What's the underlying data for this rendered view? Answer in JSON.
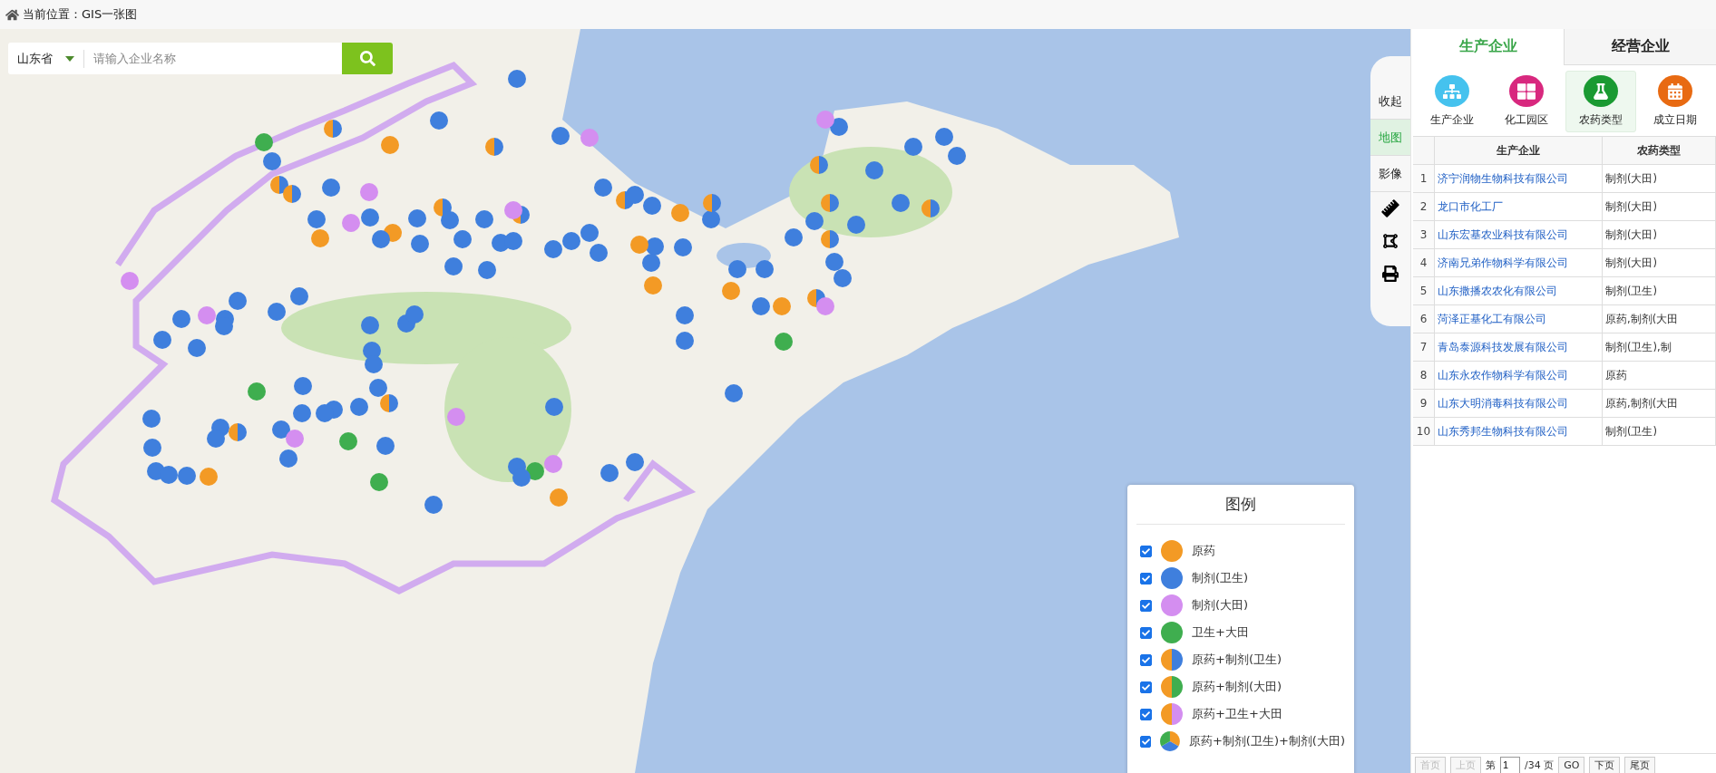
{
  "breadcrumb": {
    "label": "当前位置：GIS一张图"
  },
  "search": {
    "region": "山东省",
    "placeholder": "请输入企业名称"
  },
  "map_tools": [
    {
      "kind": "text",
      "label": "收起",
      "selected": false
    },
    {
      "kind": "text",
      "label": "地图",
      "selected": true
    },
    {
      "kind": "text",
      "label": "影像",
      "selected": false
    },
    {
      "kind": "ruler"
    },
    {
      "kind": "area"
    },
    {
      "kind": "print"
    }
  ],
  "legend": {
    "title": "图例",
    "items": [
      {
        "label": "原药",
        "checked": true,
        "segments": [
          {
            "color": "#f39a25"
          }
        ]
      },
      {
        "label": "制剂(卫生)",
        "checked": true,
        "segments": [
          {
            "color": "#3f7fdd"
          }
        ]
      },
      {
        "label": "制剂(大田)",
        "checked": true,
        "segments": [
          {
            "color": "#d48ef0"
          }
        ]
      },
      {
        "label": "卫生+大田",
        "checked": true,
        "segments": [
          {
            "color": "#3fae4f"
          }
        ]
      },
      {
        "label": "原药+制剂(卫生)",
        "checked": true,
        "segments": [
          {
            "color": "#f39a25"
          },
          {
            "color": "#3f7fdd"
          }
        ]
      },
      {
        "label": "原药+制剂(大田)",
        "checked": true,
        "segments": [
          {
            "color": "#f39a25"
          },
          {
            "color": "#3fae4f"
          }
        ]
      },
      {
        "label": "原药+卫生+大田",
        "checked": true,
        "segments": [
          {
            "color": "#f39a25"
          },
          {
            "color": "#d48ef0"
          }
        ]
      },
      {
        "label": "原药+制剂(卫生)+制剂(大田)",
        "checked": true,
        "segments": [
          {
            "color": "#f39a25"
          },
          {
            "color": "#3f7fdd"
          },
          {
            "color": "#3fae4f"
          }
        ]
      }
    ]
  },
  "tabs": [
    {
      "label": "生产企业",
      "selected": true
    },
    {
      "label": "经营企业",
      "selected": false
    }
  ],
  "categories": [
    {
      "kind": "org",
      "label": "生产企业",
      "selected": false
    },
    {
      "kind": "park",
      "label": "化工园区",
      "selected": false
    },
    {
      "kind": "pesticide",
      "label": "农药类型",
      "selected": true
    },
    {
      "kind": "date",
      "label": "成立日期",
      "selected": false
    }
  ],
  "table": {
    "columns": [
      "生产企业",
      "农药类型"
    ],
    "rows": [
      {
        "index": "1",
        "company": "济宁润物生物科技有限公司",
        "type": "制剂(大田)"
      },
      {
        "index": "2",
        "company": "龙口市化工厂",
        "type": "制剂(大田)"
      },
      {
        "index": "3",
        "company": "山东宏基农业科技有限公司",
        "type": "制剂(大田)"
      },
      {
        "index": "4",
        "company": "济南兄弟作物科学有限公司",
        "type": "制剂(大田)"
      },
      {
        "index": "5",
        "company": "山东撒播农农化有限公司",
        "type": "制剂(卫生)"
      },
      {
        "index": "6",
        "company": "菏泽正基化工有限公司",
        "type": "原药,制剂(大田"
      },
      {
        "index": "7",
        "company": "青岛泰源科技发展有限公司",
        "type": "制剂(卫生),制"
      },
      {
        "index": "8",
        "company": "山东永农作物科学有限公司",
        "type": "原药"
      },
      {
        "index": "9",
        "company": "山东大明消毒科技有限公司",
        "type": "原药,制剂(大田"
      },
      {
        "index": "10",
        "company": "山东秀邦生物科技有限公司",
        "type": "制剂(卫生)"
      }
    ]
  },
  "pager": {
    "first": "首页",
    "prev": "上页",
    "page_prefix": "第",
    "page": "1",
    "page_suffix": "/34 页",
    "go": "GO",
    "next": "下页",
    "last": "尾页"
  }
}
